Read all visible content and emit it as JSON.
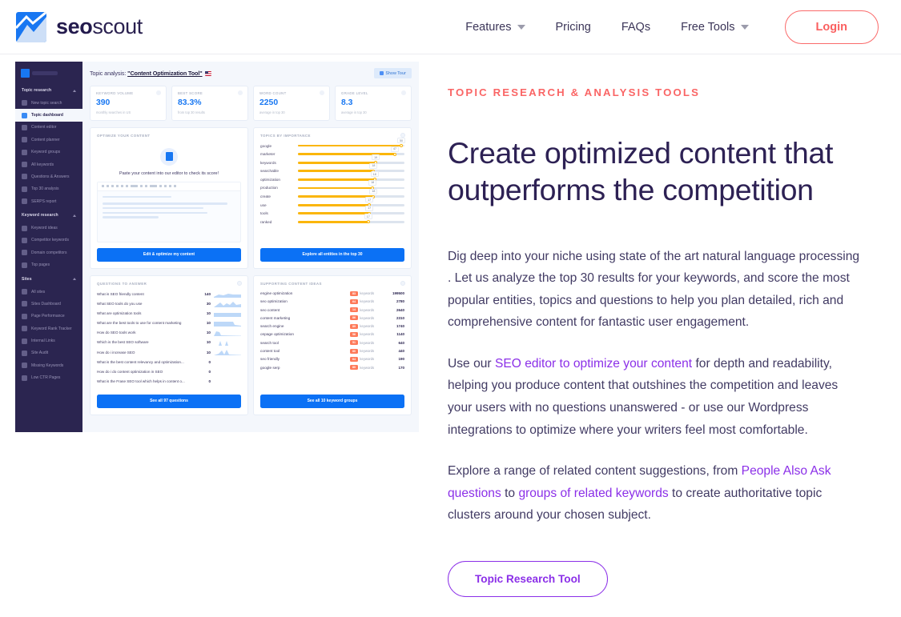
{
  "nav": {
    "brand": {
      "part1": "seo",
      "part2": "scout",
      "logo_icon": "mountain-chart-logo"
    },
    "links": [
      {
        "label": "Features",
        "has_caret": true
      },
      {
        "label": "Pricing",
        "has_caret": false
      },
      {
        "label": "FAQs",
        "has_caret": false
      },
      {
        "label": "Free Tools",
        "has_caret": true
      }
    ],
    "login_label": "Login",
    "login_color": "#fa5f5f"
  },
  "hero": {
    "eyebrow": "TOPIC RESEARCH & ANALYSIS TOOLS",
    "heading": "Create optimized content that outperforms the competition",
    "paragraph1": "Dig deep into your niche using state of the art natural language processing . Let us analyze the top 30 results for your keywords, and score the most popular entities, topics and questions to help you plan detailed, rich and comprehensive content for fantastic user engagement.",
    "p2_before": "Use our ",
    "p2_link": "SEO editor to optimize your content",
    "p2_after": " for depth and readability, helping you produce content that outshines the competition and leaves your users with no questions unanswered - or use our Wordpress integrations to optimize where your writers feel most comfortable.",
    "p3_before": "Explore a range of related content suggestions, from ",
    "p3_link1": "People Also Ask questions",
    "p3_mid": " to ",
    "p3_link2": "groups of related keywords",
    "p3_after": " to create authoritative topic clusters around your chosen subject.",
    "cta_label": "Topic Research Tool",
    "link_color": "#8b2fe8",
    "accent_color": "#fa6565",
    "heading_color": "#2d2154"
  },
  "app": {
    "sidebar": {
      "sections": [
        {
          "title": "Topic research",
          "items": [
            {
              "label": "New topic search",
              "icon": "search-icon",
              "active": false
            },
            {
              "label": "Topic dashboard",
              "icon": "grid-icon",
              "active": true
            },
            {
              "label": "Content editor",
              "icon": "document-icon",
              "active": false
            },
            {
              "label": "Content planner",
              "icon": "gear-icon",
              "active": false
            },
            {
              "label": "Keyword groups",
              "icon": "folder-icon",
              "active": false
            },
            {
              "label": "All keywords",
              "icon": "key-icon",
              "active": false
            },
            {
              "label": "Questions & Answers",
              "icon": "question-icon",
              "active": false
            },
            {
              "label": "Top 30 analysis",
              "icon": "bar-chart-icon",
              "active": false
            },
            {
              "label": "SERPS report",
              "icon": "report-icon",
              "active": false
            }
          ]
        },
        {
          "title": "Keyword research",
          "items": [
            {
              "label": "Keyword ideas",
              "icon": "bulb-icon",
              "active": false
            },
            {
              "label": "Competitor keywords",
              "icon": "versus-icon",
              "active": false
            },
            {
              "label": "Domain competitors",
              "icon": "globe-icon",
              "active": false
            },
            {
              "label": "Top pages",
              "icon": "pages-icon",
              "active": false
            }
          ]
        },
        {
          "title": "Sites",
          "items": [
            {
              "label": "All sites",
              "icon": "sites-icon",
              "active": false
            },
            {
              "label": "Sites Dashboard",
              "icon": "dashboard-icon",
              "active": false
            },
            {
              "label": "Page Performance",
              "icon": "speed-icon",
              "active": false
            },
            {
              "label": "Keyword Rank Tracker",
              "icon": "tracker-icon",
              "active": false
            },
            {
              "label": "Internal Links",
              "icon": "link-icon",
              "active": false
            },
            {
              "label": "Site Audit",
              "icon": "audit-icon",
              "active": false
            },
            {
              "label": "Missing Keywords",
              "icon": "puzzle-icon",
              "active": false
            },
            {
              "label": "Low CTR Pages",
              "icon": "chart-down-icon",
              "active": false
            }
          ]
        }
      ]
    },
    "title_prefix": "Topic analysis: ",
    "title_target": "\"Content Optimization Tool\"",
    "title_flag": "us-flag-icon",
    "tour_button": "Show Tour",
    "stats": [
      {
        "label": "KEYWORD VOLUME",
        "value": "390",
        "sub": "monthly searches in US"
      },
      {
        "label": "BEST SCORE",
        "value": "83.3%",
        "sub": "from top 30 results"
      },
      {
        "label": "WORD COUNT",
        "value": "2250",
        "sub": "average in top 30"
      },
      {
        "label": "GRADE LEVEL",
        "value": "8.3",
        "sub": "average in top 30"
      }
    ],
    "editor_panel": {
      "head": "OPTIMIZE YOUR CONTENT",
      "caption": "Paste your content into our editor to check its score!",
      "button": "Edit & optimize my content"
    },
    "topics_panel": {
      "head": "TOPICS BY IMPORTANCE",
      "button": "Explore all entities in the top 30",
      "rows": [
        {
          "name": "google",
          "value": "50",
          "pct": 97
        },
        {
          "name": "marketer",
          "value": "47",
          "pct": 91
        },
        {
          "name": "keywords",
          "value": "19",
          "pct": 73
        },
        {
          "name": "searchable",
          "value": "18",
          "pct": 71
        },
        {
          "name": "optimization",
          "value": "18",
          "pct": 72
        },
        {
          "name": "production",
          "value": "18",
          "pct": 70
        },
        {
          "name": "create",
          "value": "18",
          "pct": 71
        },
        {
          "name": "use",
          "value": "17",
          "pct": 67
        },
        {
          "name": "tools",
          "value": "17",
          "pct": 67
        },
        {
          "name": "ranked",
          "value": "17",
          "pct": 66
        }
      ]
    },
    "questions_panel": {
      "head": "QUESTIONS TO ANSWER",
      "button": "See all 97 questions",
      "rows": [
        {
          "text": "What is SEO friendly content",
          "value": "140"
        },
        {
          "text": "What SEO tools do you use",
          "value": "30"
        },
        {
          "text": "What are optimization tools",
          "value": "10"
        },
        {
          "text": "What are the best tools to use for content marketing",
          "value": "10"
        },
        {
          "text": "How do SEO tools work",
          "value": "10"
        },
        {
          "text": "Which is the best SEO software",
          "value": "10"
        },
        {
          "text": "How do i increase SEO",
          "value": "10"
        },
        {
          "text": "What is the best content relevancy and optimization...",
          "value": "0"
        },
        {
          "text": "How do i do content optimization in SEO",
          "value": "0"
        },
        {
          "text": "What is the Frase SEO tool which helps in content o...",
          "value": "0"
        }
      ]
    },
    "ideas_panel": {
      "head": "SUPPORTING CONTENT IDEAS",
      "button": "See all 10 keyword groups",
      "kw_label": "keywords",
      "rows": [
        {
          "name": "engine optimization",
          "count": "83",
          "volume": "199500"
        },
        {
          "name": "seo optimization",
          "count": "64",
          "volume": "2780"
        },
        {
          "name": "seo content",
          "count": "14",
          "volume": "2640"
        },
        {
          "name": "content marketing",
          "count": "86",
          "volume": "2310"
        },
        {
          "name": "search engine",
          "count": "89",
          "volume": "1740"
        },
        {
          "name": "onpage optimization",
          "count": "56",
          "volume": "1140"
        },
        {
          "name": "search tool",
          "count": "51",
          "volume": "640"
        },
        {
          "name": "content tool",
          "count": "80",
          "volume": "440"
        },
        {
          "name": "seo friendly",
          "count": "64",
          "volume": "190"
        },
        {
          "name": "google serp",
          "count": "80",
          "volume": "170"
        }
      ]
    }
  }
}
